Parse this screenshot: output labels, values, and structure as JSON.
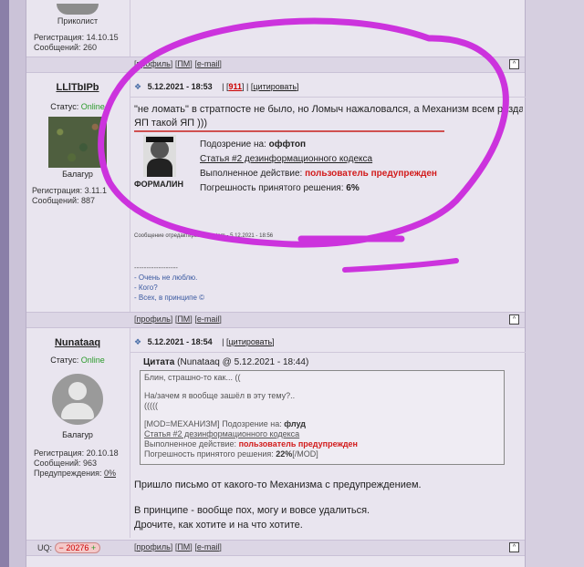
{
  "post0": {
    "author_nick": "Приколист",
    "reg_label": "Регистрация: 14.10.15",
    "msgs_label": "Сообщений: 260"
  },
  "footer_links": {
    "profile": "профиль",
    "pm": "ПМ",
    "email": "e-mail",
    "open_b": "[",
    "close_b": "]",
    "up": "^"
  },
  "post1": {
    "author_nick": "LLlTbIPb",
    "status_label": "Статус:",
    "status_value": "Online",
    "rank": "Балагур",
    "reg_label": "Регистрация: 3.11.1",
    "msgs_label": "Сообщений: 887",
    "date": "5.12.2021 - 18:53",
    "post_number": "911",
    "quote_link": "цитировать",
    "text_line1": "\"не ломать\" в стратпосте не было, но Ломыч нажаловался, а Механизм всем раздал...",
    "text_line2": "ЯП такой ЯП )))",
    "mod": {
      "avatar_caption": "ФОРМАЛИН",
      "suspicion_label": "Подозрение на:",
      "suspicion_value": "оффтоп",
      "article": "Статья #2 дезинформационного кодекса",
      "action_label": "Выполненное действие:",
      "action_value": "пользователь предупрежден",
      "error_label": "Погрешность принятого решения:",
      "error_value": "6%"
    },
    "edited_note": "Сообщение отредактировал system - 5.12.2021 - 18:56",
    "signature_rule": "------------------",
    "signature": [
      "- Очень не люблю.",
      "- Кого?",
      "- Всех, в принципе ©"
    ]
  },
  "post2": {
    "author_nick": "Nunataaq",
    "status_label": "Статус:",
    "status_value": "Online",
    "rank": "Балагур",
    "reg_label": "Регистрация: 20.10.18",
    "msgs_label": "Сообщений: 963",
    "warn_label": "Предупреждения:",
    "warn_value": "0%",
    "date": "5.12.2021 - 18:54",
    "quote_link": "цитировать",
    "quote_header_bold": "Цитата",
    "quote_header_rest": "(Nunataaq @ 5.12.2021 - 18:44)",
    "quote_lines": [
      "Блин, страшно-то как... ((",
      "",
      "На/зачем я вообще зашёл в эту тему?..",
      "(((((",
      ""
    ],
    "quote_mod_prefix": "[MOD=МЕХАНИЗМ]",
    "quote_mod_suspicion_label": "Подозрение на:",
    "quote_mod_suspicion_value": "флуд",
    "quote_mod_article": "Статья #2 дезинформационного кодекса",
    "quote_mod_action_label": "Выполненное действие:",
    "quote_mod_action_value": "пользователь предупрежден",
    "quote_mod_error": "Погрешность принятого решения:",
    "quote_mod_error_value": "22%",
    "quote_mod_close": "[/MOD]",
    "text": [
      "Пришло письмо от какого-то Механизма с предупреждением.",
      "",
      "В принципе - вообще пох, могу и вовсе удалиться.",
      "Дрочите, как хотите и на что хотите."
    ],
    "uq_label": "UQ:",
    "uq_value": "20276"
  },
  "colors": {
    "annotation": "#cc33dd",
    "warning_red": "#d21b1b",
    "online_green": "#2a9a2a"
  }
}
